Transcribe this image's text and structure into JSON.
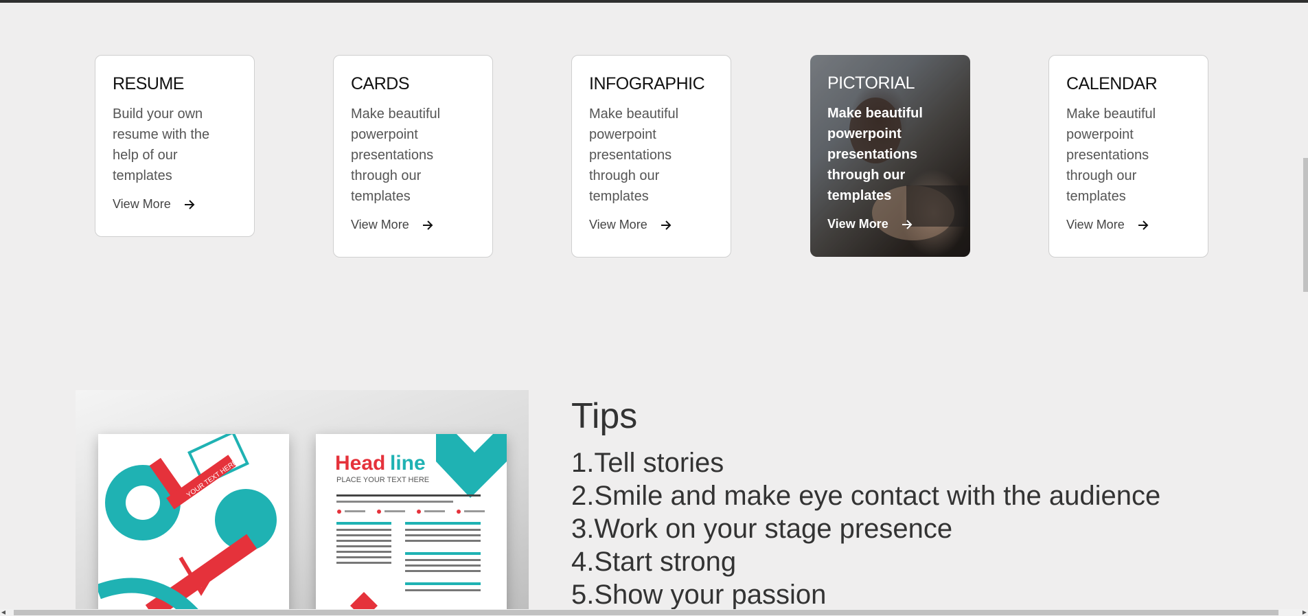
{
  "cards": [
    {
      "title": "RESUME",
      "description": "Build your own resume with the help of our templates",
      "link": "View More",
      "featured": false
    },
    {
      "title": "CARDS",
      "description": "Make beautiful powerpoint presentations through our templates",
      "link": "View More",
      "featured": false
    },
    {
      "title": "INFOGRAPHIC",
      "description": "Make beautiful powerpoint presentations through our templates",
      "link": "View More",
      "featured": false
    },
    {
      "title": "PICTORIAL",
      "description": "Make beautiful powerpoint presentations through our templates",
      "link": "View More",
      "featured": true
    },
    {
      "title": "CALENDAR",
      "description": "Make beautiful powerpoint presentations through our templates",
      "link": "View More",
      "featured": false
    }
  ],
  "promo_image": {
    "icon": "flyer-template-image",
    "right_flyer_heading_a": "Head",
    "right_flyer_heading_b": "line",
    "right_flyer_sub": "PLACE YOUR TEXT HERE",
    "left_flyer_band": "YOUR TEXT HERE"
  },
  "tips": {
    "title": "Tips",
    "items": [
      "1.Tell stories",
      "2.Smile and make eye contact with the audience",
      "3.Work on your stage presence",
      "4.Start strong",
      "5.Show your passion"
    ]
  },
  "colors": {
    "background": "#efeeee",
    "card_background": "#ffffff",
    "accent_teal": "#1fb2b3",
    "accent_red": "#e5323b"
  }
}
